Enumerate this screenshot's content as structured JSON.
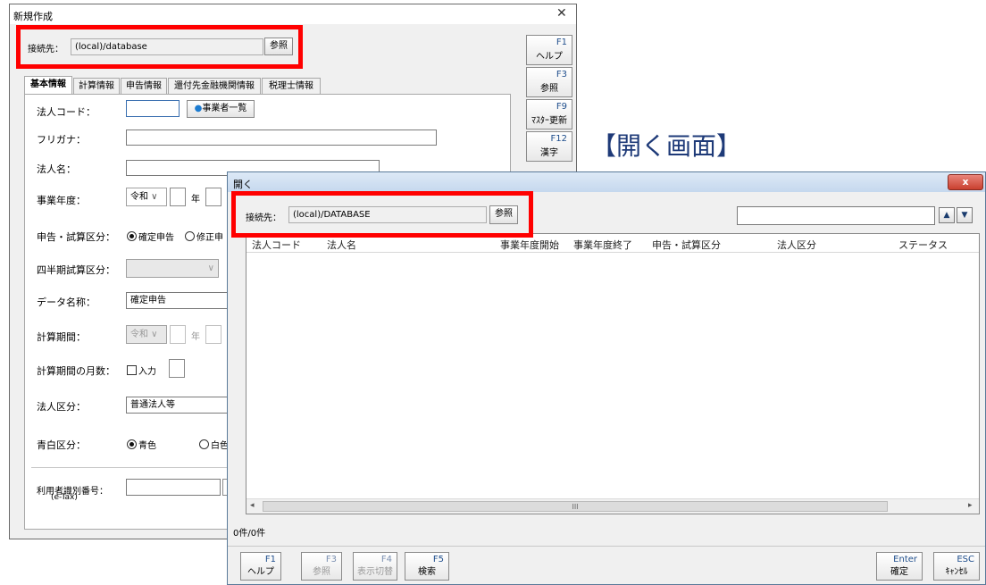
{
  "annotation": "【開く画面】",
  "new_window": {
    "title": "新規作成",
    "connection": {
      "label": "接続先：",
      "value": "(local)/database",
      "browse": "参照"
    },
    "tabs": [
      "基本情報",
      "計算情報",
      "申告情報",
      "還付先金融機関情報",
      "税理士情報"
    ],
    "fkeys": [
      {
        "key": "F1",
        "label": "ヘルプ"
      },
      {
        "key": "F3",
        "label": "参照"
      },
      {
        "key": "F9",
        "label": "ﾏｽﾀｰ更新"
      },
      {
        "key": "F12",
        "label": "漢字"
      }
    ],
    "form": {
      "corp_code_label": "法人コード：",
      "corp_code_value": "",
      "business_list_button": "事業者一覧",
      "furigana_label": "フリガナ：",
      "name_label": "法人名：",
      "fiscal_year_label": "事業年度：",
      "era_value": "令和",
      "year_suffix": "年",
      "filing_type_label": "申告・試算区分：",
      "filing_options": [
        "確定申告",
        "修正申"
      ],
      "quarter_label": "四半期試算区分：",
      "data_name_label": "データ名称：",
      "data_name_value": "確定申告",
      "calc_period_label": "計算期間：",
      "calc_era": "令和",
      "months_label": "計算期間の月数：",
      "months_checkbox": "入力",
      "corp_type_label": "法人区分：",
      "corp_type_value": "普通法人等",
      "color_label": "青白区分：",
      "color_options": [
        "青色",
        "白色"
      ],
      "user_id_label": "利用者識別番号：",
      "user_id_sub": "(e-Tax)"
    }
  },
  "open_window": {
    "title": "開く",
    "close_glyph": "x",
    "connection": {
      "label": "接続先：",
      "value": "(local)/DATABASE",
      "browse": "参照"
    },
    "search_value": "",
    "up": "▲",
    "down": "▼",
    "columns": [
      "法人コード",
      "法人名",
      "事業年度開始",
      "事業年度終了",
      "申告・試算区分",
      "法人区分",
      "ステータス"
    ],
    "count": "0件/0件",
    "scroll_mid": "III",
    "fkeys_left": [
      {
        "key": "F1",
        "label": "ヘルプ"
      },
      {
        "key": "F3",
        "label": "参照"
      },
      {
        "key": "F4",
        "label": "表示切替"
      },
      {
        "key": "F5",
        "label": "検索"
      }
    ],
    "fkeys_right": [
      {
        "key": "Enter",
        "label": "確定"
      },
      {
        "key": "ESC",
        "label": "ｷｬﾝｾﾙ"
      }
    ]
  }
}
